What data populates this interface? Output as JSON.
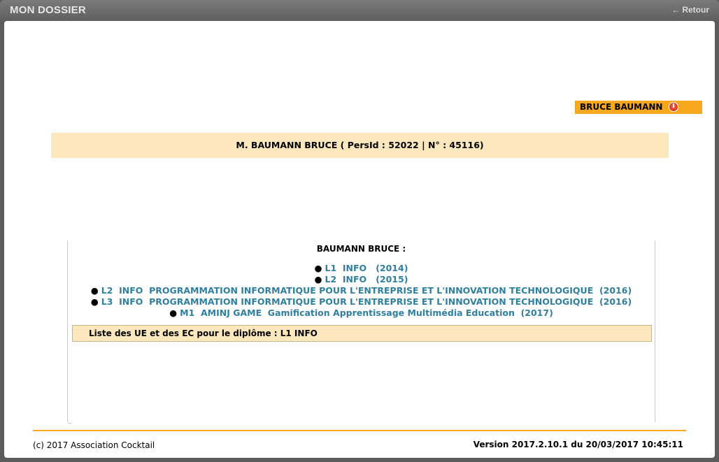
{
  "window": {
    "title": "MON DOSSIER",
    "back_label": "Retour",
    "back_icon": "arrow-left-icon"
  },
  "user_badge": {
    "name": "BRUCE BAUMANN",
    "logout_icon": "power-icon",
    "color": "#f8a81c"
  },
  "identity": {
    "text": "M. BAUMANN BRUCE ( PersId : 52022 | N° : 45116)"
  },
  "panel": {
    "heading": "BAUMANN BRUCE :",
    "diplomas": [
      {
        "label": "L1  INFO   (2014)"
      },
      {
        "label": "L2  INFO   (2015)"
      },
      {
        "label": "L2  INFO  PROGRAMMATION INFORMATIQUE POUR L'ENTREPRISE ET L'INNOVATION TECHNOLOGIQUE  (2016)"
      },
      {
        "label": "L3  INFO  PROGRAMMATION INFORMATIQUE POUR L'ENTREPRISE ET L'INNOVATION TECHNOLOGIQUE  (2016)"
      },
      {
        "label": "M1  AMINJ GAME  Gamification Apprentissage Multimédia Education  (2017)"
      }
    ],
    "ue_title": "Liste des UE et des EC pour le diplôme : L1  INFO"
  },
  "footer": {
    "copyright": "(c) 2017 Association Cocktail",
    "version": "Version 2017.2.10.1 du 20/03/2017 10:45:11"
  },
  "colors": {
    "accent": "#f8a81c",
    "highlight_bg": "#fde7bd",
    "link": "#2f7fa1",
    "titlebar": "#6a6a6a"
  }
}
